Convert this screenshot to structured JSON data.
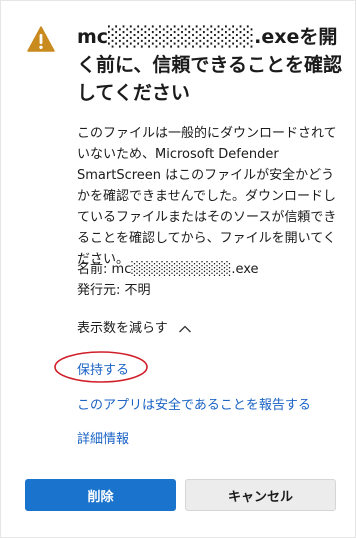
{
  "dialog": {
    "title": "mc░░░░░░░░░░.exeを開く前に、信頼できることを確認してください",
    "description": "このファイルは一般的にダウンロードされていないため、Microsoft Defender SmartScreen はこのファイルが安全かどうかを確認できませんでした。ダウンロードしているファイルまたはそのソースが信頼できることを確認してから、ファイルを開いてください。",
    "name_label": "名前:",
    "name_value": "mc░░░░░░░░░░.exe",
    "publisher_label": "発行元:",
    "publisher_value": "不明",
    "show_fewer": "表示数を減らす",
    "keep_link": "保持する",
    "report_link": "このアプリは安全であることを報告する",
    "more_info_link": "詳細情報",
    "delete_button": "削除",
    "cancel_button": "キャンセル"
  },
  "icons": {
    "warning": "warning-icon",
    "collapse": "chevron-up-icon"
  },
  "colors": {
    "warning_icon": "#d08a1a",
    "link": "#1a63c5",
    "primary_button": "#1a73cc",
    "annotation_circle": "#d11f2a"
  }
}
